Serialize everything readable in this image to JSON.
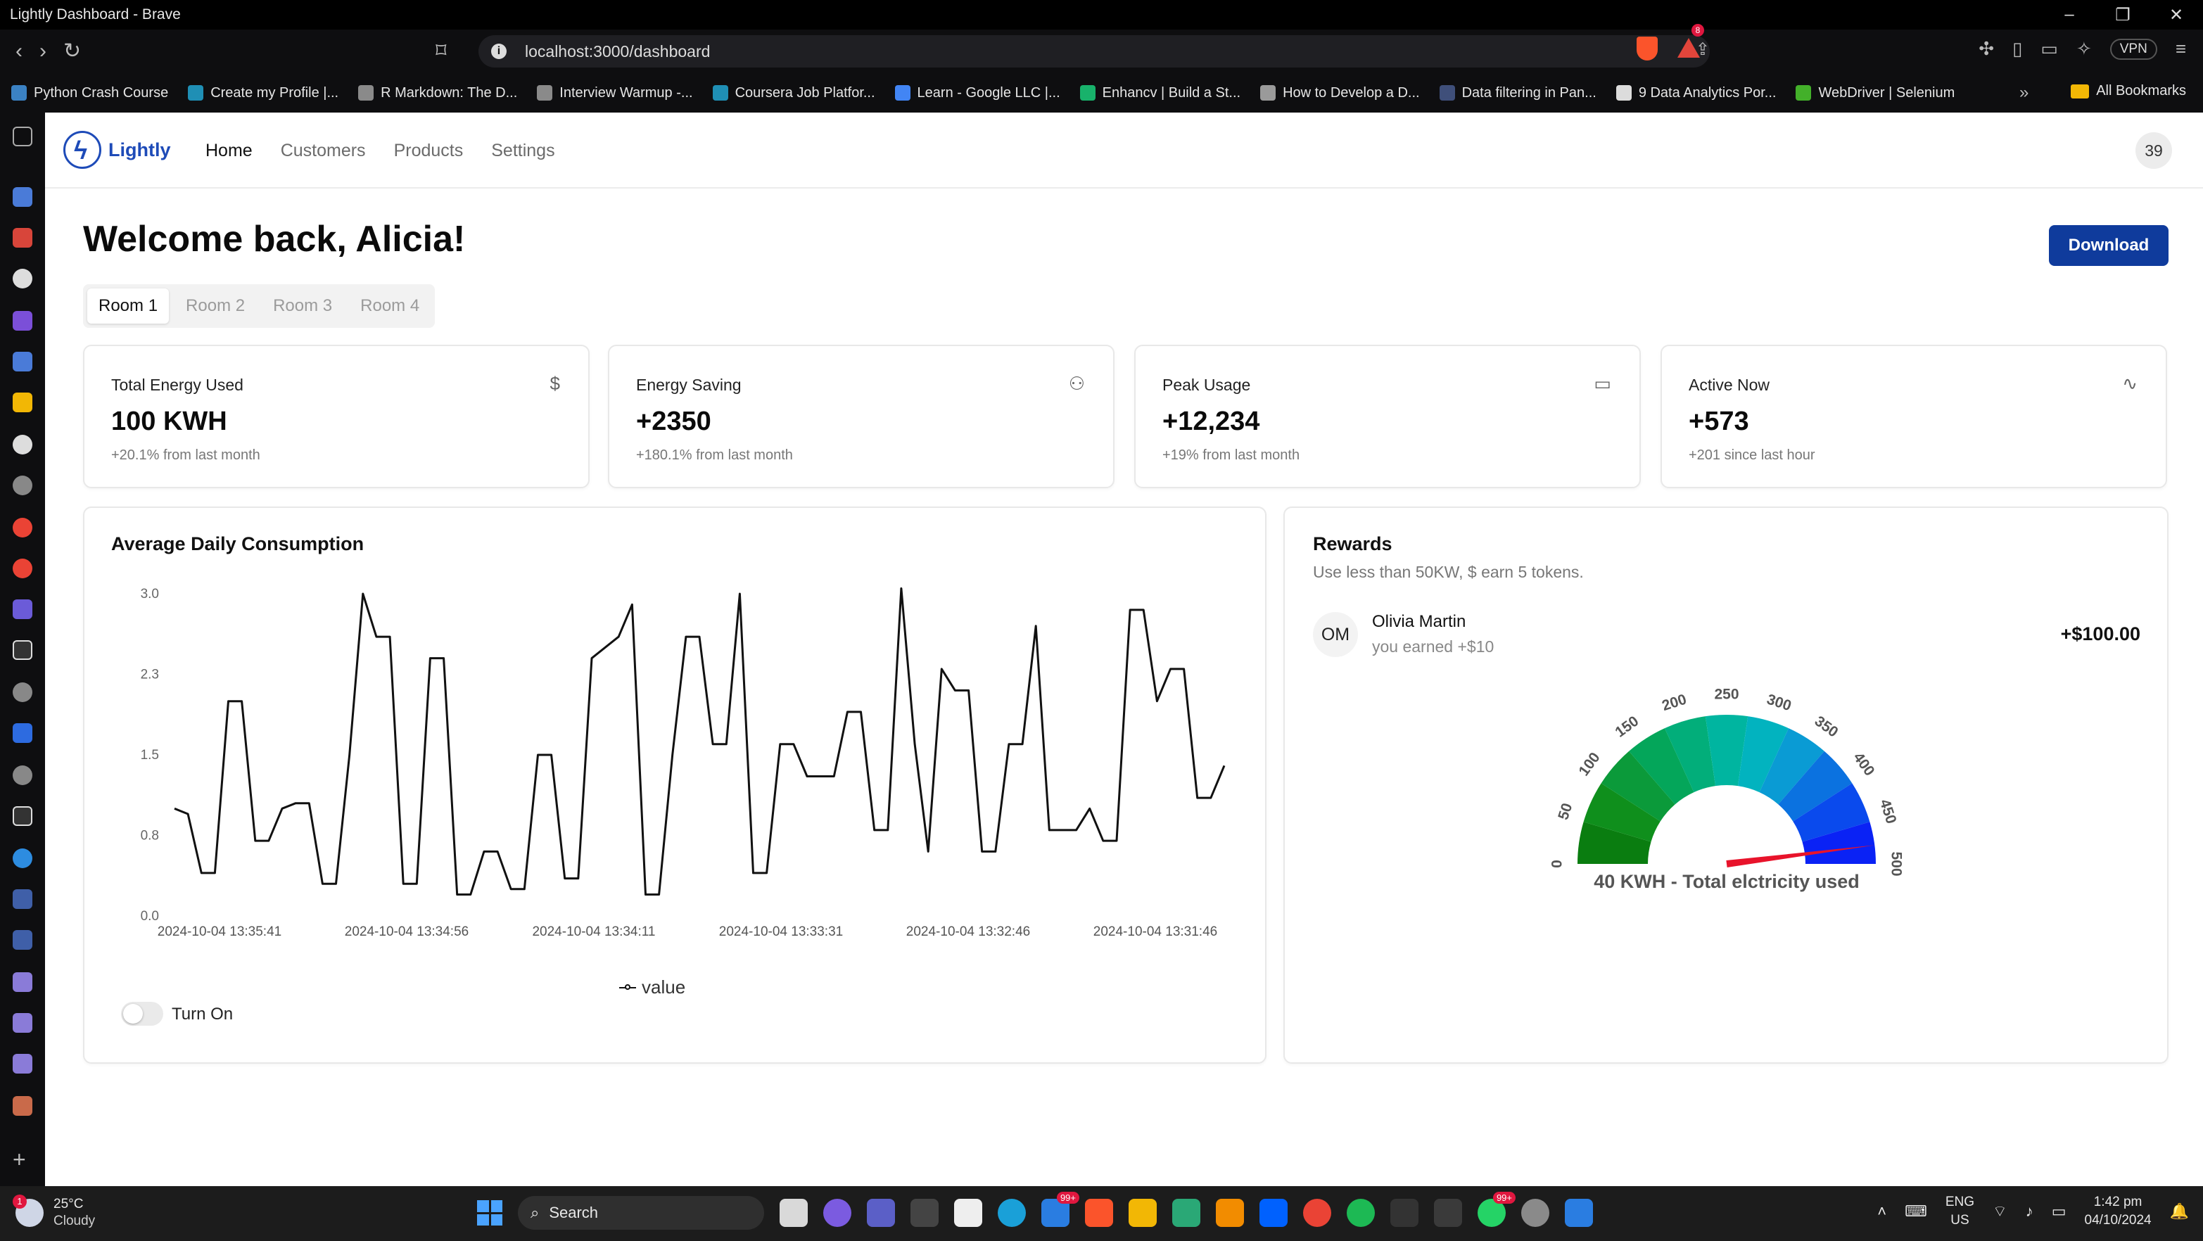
{
  "window": {
    "title": "Lightly Dashboard - Brave"
  },
  "browser": {
    "url": "localhost:3000/dashboard",
    "rewards_badge": "8",
    "vpn_label": "VPN",
    "bookmarks": [
      {
        "label": "Python Crash Course",
        "color": "#3b82c4"
      },
      {
        "label": "Create my Profile |...",
        "color": "#1f8fb5"
      },
      {
        "label": "R Markdown: The D...",
        "color": "#8a8a8a"
      },
      {
        "label": "Interview Warmup -...",
        "color": "#8a8a8a"
      },
      {
        "label": "Coursera Job Platfor...",
        "color": "#1f8fb5"
      },
      {
        "label": "Learn - Google LLC |...",
        "color": "#4285f4"
      },
      {
        "label": "Enhancv | Build a St...",
        "color": "#18b26b"
      },
      {
        "label": "How to Develop a D...",
        "color": "#9a9a9a"
      },
      {
        "label": "Data filtering in Pan...",
        "color": "#3f4f7a"
      },
      {
        "label": "9 Data Analytics Por...",
        "color": "#dcdcdc"
      },
      {
        "label": "WebDriver | Selenium",
        "color": "#43b02a"
      }
    ],
    "all_bookmarks": "All Bookmarks"
  },
  "app": {
    "brand": "Lightly",
    "nav": {
      "home": "Home",
      "customers": "Customers",
      "products": "Products",
      "settings": "Settings"
    },
    "user_avatar": "39",
    "welcome": "Welcome back, Alicia!",
    "download_label": "Download",
    "rooms": [
      "Room 1",
      "Room 2",
      "Room 3",
      "Room 4"
    ],
    "stats": [
      {
        "label": "Total Energy Used",
        "icon": "dollar-icon",
        "value": "100 KWH",
        "sub": "+20.1% from last month"
      },
      {
        "label": "Energy Saving",
        "icon": "users-icon",
        "value": "+2350",
        "sub": "+180.1% from last month"
      },
      {
        "label": "Peak Usage",
        "icon": "credit-card-icon",
        "value": "+12,234",
        "sub": "+19% from last month"
      },
      {
        "label": "Active Now",
        "icon": "activity-icon",
        "value": "+573",
        "sub": "+201 since last hour"
      }
    ],
    "chart_title": "Average Daily Consumption",
    "toggle_label": "Turn On",
    "rewards": {
      "title": "Rewards",
      "description": "Use less than 50KW, $ earn 5 tokens.",
      "entry": {
        "initials": "OM",
        "name": "Olivia Martin",
        "sub": "you earned +$10",
        "amount": "+$100.00"
      },
      "gauge": {
        "label": "40 KWH - Total elctricity used",
        "min": 0,
        "max": 500,
        "value": 480,
        "ticks": [
          "0",
          "50",
          "100",
          "150",
          "200",
          "250",
          "300",
          "350",
          "400",
          "450",
          "500"
        ],
        "colors": [
          "#0a7d10",
          "#0f8f1c",
          "#0b9a3a",
          "#04a65a",
          "#02ae7a",
          "#00b5a0",
          "#02b3bf",
          "#0a9bd4",
          "#0b72e0",
          "#0a4aed",
          "#0a22f5"
        ],
        "needle_color": "#e8132b"
      }
    }
  },
  "chart_data": {
    "type": "line",
    "title": "Average Daily Consumption",
    "legend": "value",
    "yticks": [
      "0.0",
      "0.8",
      "1.5",
      "2.3",
      "3.0"
    ],
    "ylim": [
      0,
      3.0
    ],
    "xtick_labels": [
      "2024-10-04 13:35:41",
      "2024-10-04 13:34:56",
      "2024-10-04 13:34:11",
      "2024-10-04 13:33:31",
      "2024-10-04 13:32:46",
      "2024-10-04 13:31:46"
    ],
    "series": [
      {
        "name": "value",
        "values": [
          1.0,
          0.95,
          0.4,
          0.4,
          2.0,
          2.0,
          0.7,
          0.7,
          1.0,
          1.05,
          1.05,
          0.3,
          0.3,
          1.5,
          3.0,
          2.6,
          2.6,
          0.3,
          0.3,
          2.4,
          2.4,
          0.2,
          0.2,
          0.6,
          0.6,
          0.25,
          0.25,
          1.5,
          1.5,
          0.35,
          0.35,
          2.4,
          2.5,
          2.6,
          2.9,
          0.2,
          0.2,
          1.5,
          2.6,
          2.6,
          1.6,
          1.6,
          3.0,
          0.4,
          0.4,
          1.6,
          1.6,
          1.3,
          1.3,
          1.3,
          1.9,
          1.9,
          0.8,
          0.8,
          3.05,
          1.6,
          0.6,
          2.3,
          2.1,
          2.1,
          0.6,
          0.6,
          1.6,
          1.6,
          2.7,
          0.8,
          0.8,
          0.8,
          1.0,
          0.7,
          0.7,
          2.85,
          2.85,
          2.0,
          2.3,
          2.3,
          1.1,
          1.1,
          1.4
        ]
      }
    ]
  }
}
